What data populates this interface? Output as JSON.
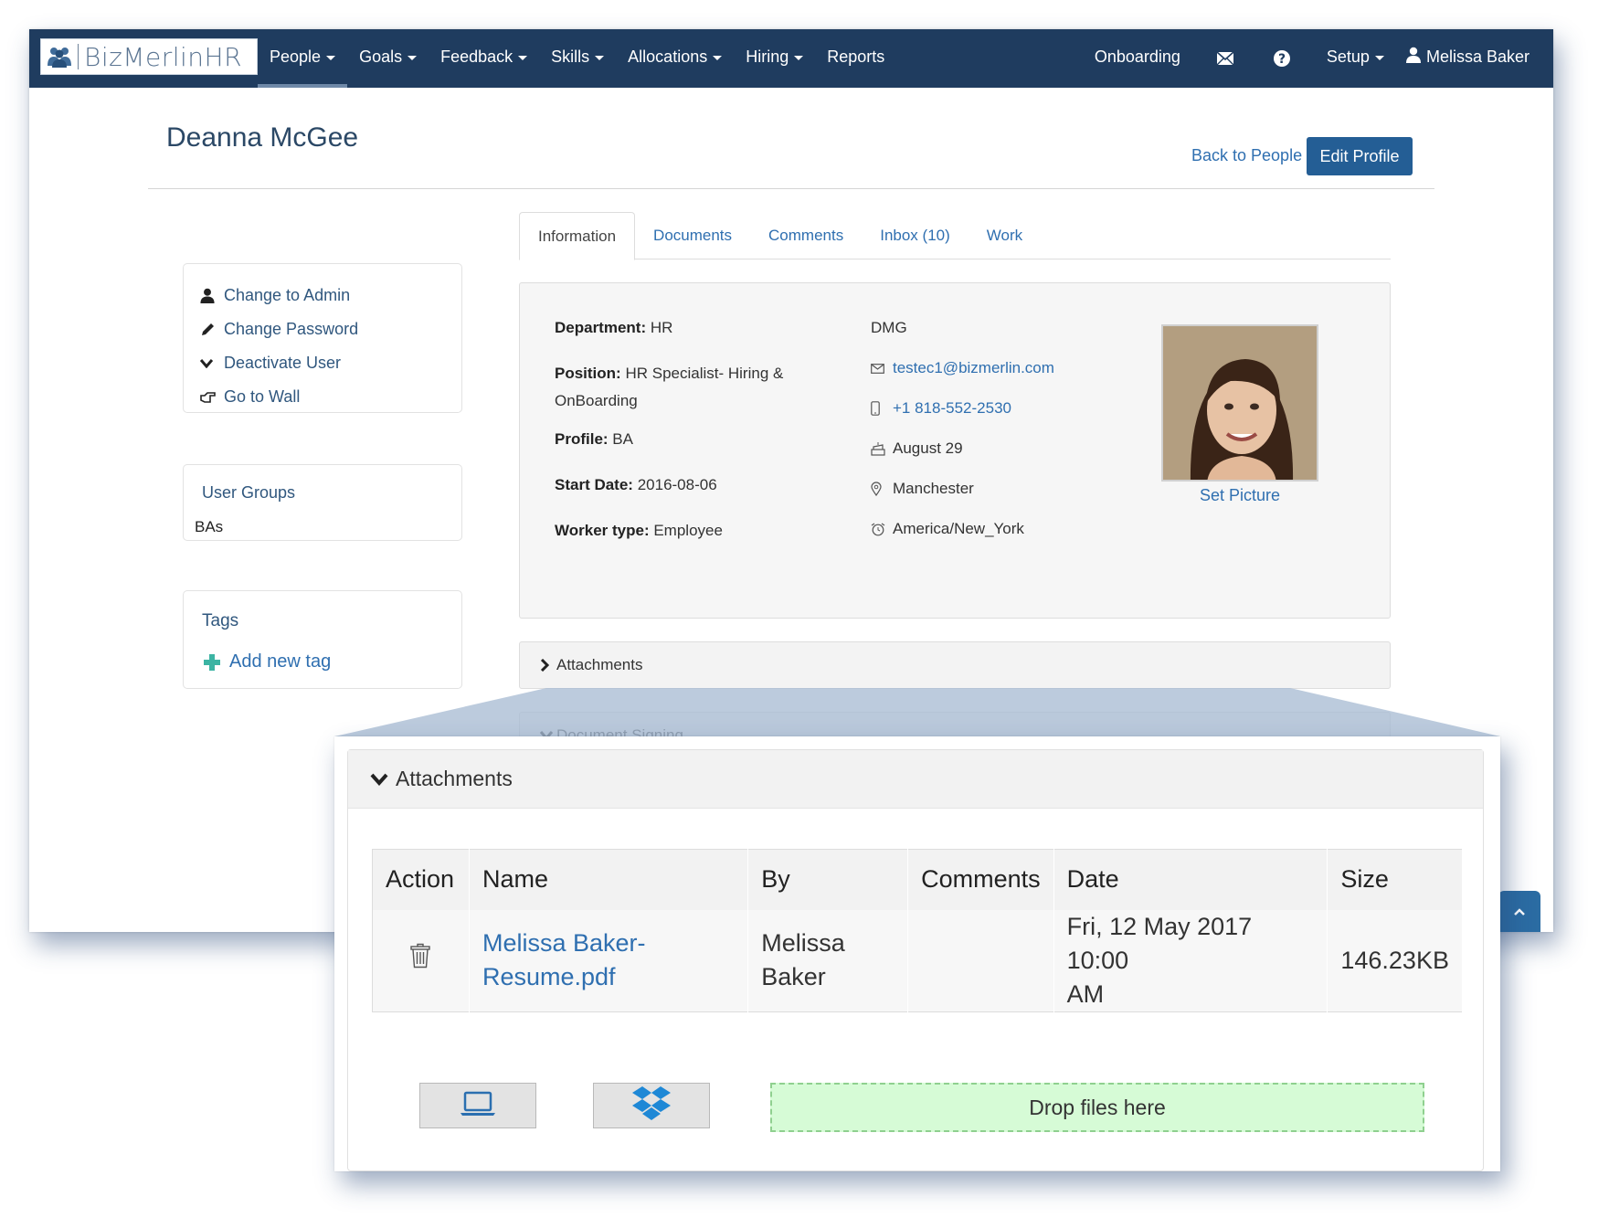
{
  "app": {
    "logo_text": "BizMerlinHR",
    "nav": [
      {
        "label": "People",
        "dropdown": true,
        "active": true
      },
      {
        "label": "Goals",
        "dropdown": true
      },
      {
        "label": "Feedback",
        "dropdown": true
      },
      {
        "label": "Skills",
        "dropdown": true
      },
      {
        "label": "Allocations",
        "dropdown": true
      },
      {
        "label": "Hiring",
        "dropdown": true
      },
      {
        "label": "Reports",
        "dropdown": false
      }
    ],
    "nav_right": {
      "onboarding": "Onboarding",
      "mail_icon": "envelope-icon",
      "help_icon": "question-circle-icon",
      "setup": "Setup",
      "user": "Melissa Baker"
    }
  },
  "profile": {
    "name": "Deanna McGee",
    "back_link": "Back to People",
    "edit_button": "Edit Profile"
  },
  "sidebar": {
    "actions": [
      {
        "label": "Change to Admin",
        "icon": "user-icon"
      },
      {
        "label": "Change Password",
        "icon": "pencil-icon"
      },
      {
        "label": "Deactivate User",
        "icon": "chevron-down-icon"
      },
      {
        "label": "Go to Wall",
        "icon": "hand-point-icon"
      }
    ],
    "groups_title": "User Groups",
    "groups_value": "BAs",
    "tags_title": "Tags",
    "add_tag": "Add new tag"
  },
  "tabs": [
    "Information",
    "Documents",
    "Comments",
    "Inbox (10)",
    "Work"
  ],
  "info": {
    "department_label": "Department:",
    "department_value": "HR",
    "position_label": "Position:",
    "position_value": "HR Specialist- Hiring & OnBoarding",
    "profile_label": "Profile:",
    "profile_value": "BA",
    "start_label": "Start Date:",
    "start_value": "2016-08-06",
    "worker_label": "Worker type:",
    "worker_value": "Employee",
    "company": "DMG",
    "email": "testec1@bizmerlin.com",
    "phone": "+1 818-552-2530",
    "birthday": "August 29",
    "location": "Manchester",
    "timezone": "America/New_York",
    "set_picture": "Set Picture"
  },
  "sections": {
    "attachments": "Attachments",
    "document_signing": "Document Signing"
  },
  "attachments_zoom": {
    "title": "Attachments",
    "columns": [
      "Action",
      "Name",
      "By",
      "Comments",
      "Date",
      "Size"
    ],
    "rows": [
      {
        "name_line1": "Melissa Baker-",
        "name_line2": "Resume.pdf",
        "by_line1": "Melissa",
        "by_line2": "Baker",
        "comments": "",
        "date_line1": "Fri, 12 May 2017 10:00",
        "date_line2": "AM",
        "size": "146.23KB"
      }
    ],
    "drop_text": "Drop files here"
  },
  "colors": {
    "navbar": "#1f3c5f",
    "link": "#2f6fb0",
    "button": "#245e95",
    "dropzone": "#d6fbd6"
  }
}
